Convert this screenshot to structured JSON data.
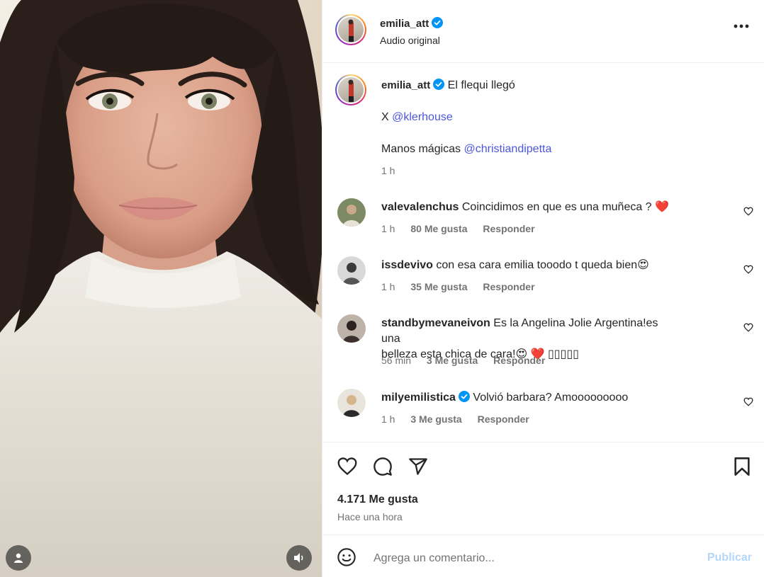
{
  "post": {
    "username": "emilia_att",
    "subtitle": "Audio original"
  },
  "caption": {
    "username": "emilia_att",
    "line1": "El flequi llegó",
    "line2_prefix": "X",
    "line2_mention": "@klerhouse",
    "line3_prefix": "Manos mágicas",
    "line3_mention": "@christiandipetta",
    "time": "1 h"
  },
  "comments": [
    {
      "username": "valevalenchus",
      "text": "Coincidimos en que es una muñeca ? ",
      "emoji": "❤️",
      "time": "1 h",
      "likes": "80 Me gusta",
      "reply": "Responder"
    },
    {
      "username": "issdevivo",
      "text": "con esa cara emilia tooodo t queda bien",
      "emoji": "😍",
      "time": "1 h",
      "likes": "35 Me gusta",
      "reply": "Responder"
    },
    {
      "username": "standbymevaneivon",
      "text": "Es la Angelina Jolie Argentina!es una",
      "text2": "belleza esta chica de cara!",
      "emoji": "😍 ❤️ ▯▯▯▯▯",
      "time": "56 min",
      "likes": "3 Me gusta",
      "reply": "Responder"
    },
    {
      "username": "milyemilistica",
      "text": "Volvió barbara? Amooooooooo",
      "time": "1 h",
      "likes": "3 Me gusta",
      "reply": "Responder"
    }
  ],
  "stats": {
    "likes": "4.171 Me gusta",
    "time_ago": "Hace una hora"
  },
  "composer": {
    "placeholder": "Agrega un comentario...",
    "publish": "Publicar"
  },
  "colors": {
    "verified": "#0095f6",
    "mention": "#4c57d8",
    "publish_disabled": "#b3d6f9"
  },
  "icons": [
    "user-icon",
    "speaker-icon",
    "more-icon",
    "verified-icon",
    "heart-icon",
    "comment-icon",
    "share-icon",
    "bookmark-icon",
    "emoji-icon"
  ]
}
